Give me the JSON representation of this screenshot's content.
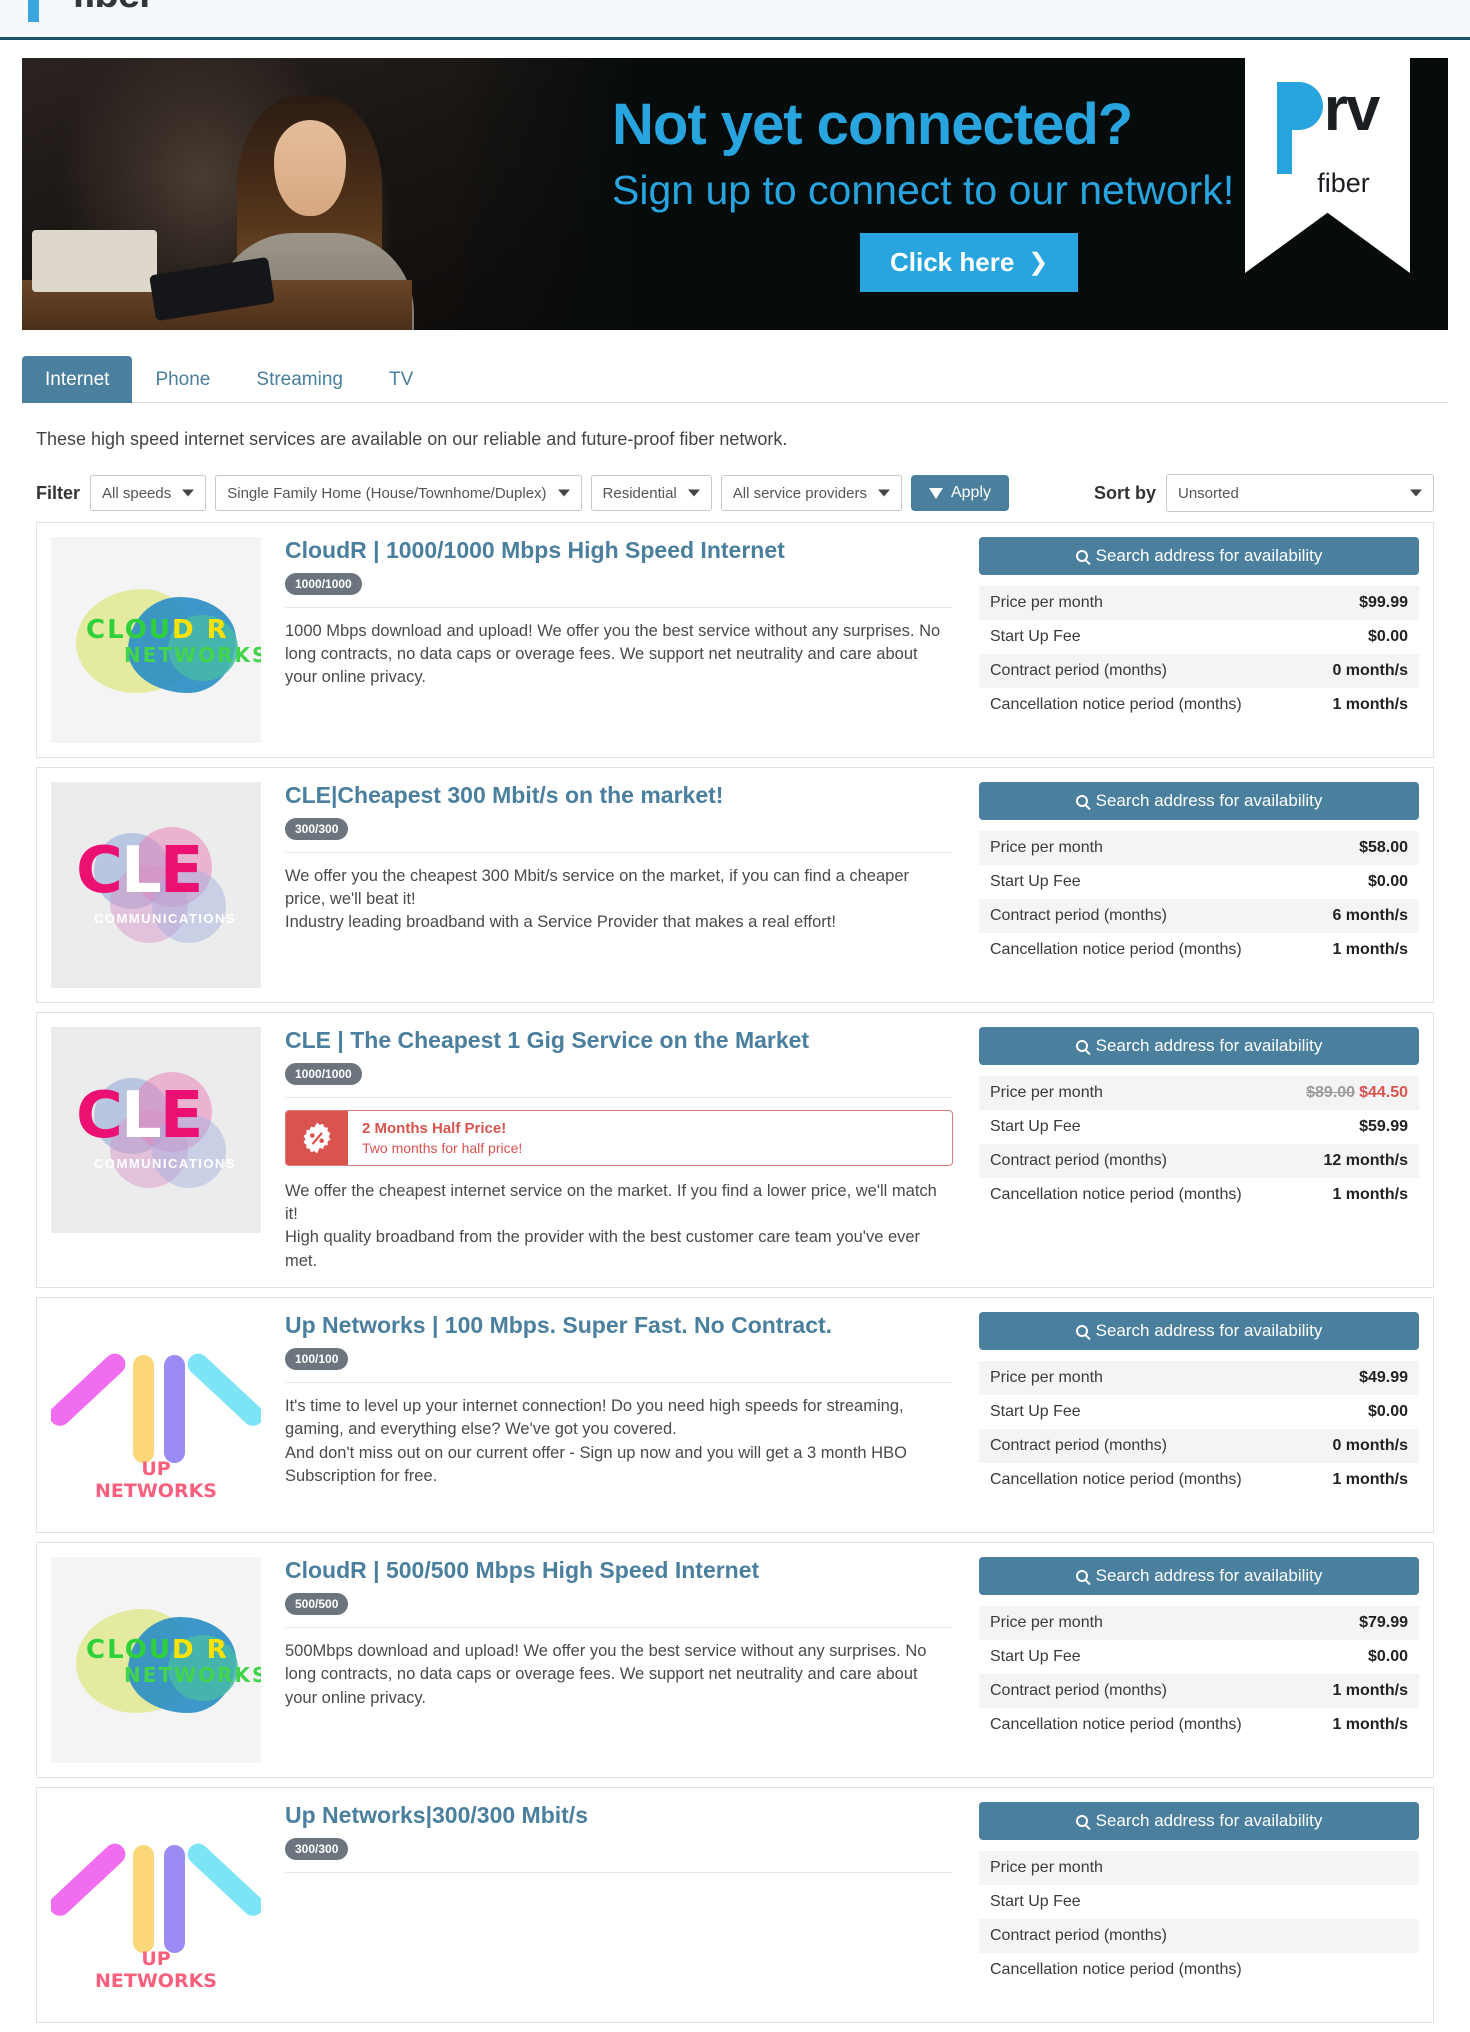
{
  "header": {
    "brand": "fiber",
    "logo_icon": "prv-p-mark-icon"
  },
  "banner": {
    "headline": "Not yet connected?",
    "subheadline": "Sign up to connect to our network!",
    "cta_label": "Click here",
    "cta_chevron": "❯",
    "ribbon_brand_rv": "rv",
    "ribbon_brand_sub": "fiber",
    "ribbon_icon": "prv-fiber-ribbon-logo-icon"
  },
  "tabs": [
    {
      "label": "Internet",
      "active": true
    },
    {
      "label": "Phone",
      "active": false
    },
    {
      "label": "Streaming",
      "active": false
    },
    {
      "label": "TV",
      "active": false
    }
  ],
  "intro": "These high speed internet services are available on our reliable and future-proof fiber network.",
  "filters": {
    "label": "Filter",
    "speed": "All speeds",
    "home_type": "Single Family Home (House/Townhome/Duplex)",
    "segment": "Residential",
    "provider": "All service providers",
    "apply_label": "Apply",
    "apply_icon": "funnel-icon"
  },
  "sort": {
    "label": "Sort by",
    "value": "Unsorted"
  },
  "spec_labels": {
    "price": "Price per month",
    "startup": "Start Up Fee",
    "contract": "Contract period (months)",
    "cancellation": "Cancellation notice period (months)"
  },
  "search_button_label": "Search address for availability",
  "search_button_icon": "magnifier-icon",
  "products": [
    {
      "logo_kind": "cloudr",
      "logo_alt": "cloudr-networks-logo",
      "title": "CloudR | 1000/1000 Mbps High Speed Internet",
      "speed_badge": "1000/1000",
      "description": "1000 Mbps download and upload! We offer you the best service without any surprises. No long contracts, no data caps or overage fees. We support net neutrality and care about your online privacy.",
      "promo": null,
      "price": "$99.99",
      "price_old": null,
      "startup": "$0.00",
      "contract": "0 month/s",
      "cancellation": "1 month/s"
    },
    {
      "logo_kind": "cle",
      "logo_alt": "cle-communications-logo",
      "title": "CLE|Cheapest 300 Mbit/s on the market!",
      "speed_badge": "300/300",
      "description": "We offer you the cheapest 300 Mbit/s service on the market, if you can find a cheaper price, we'll beat it!\nIndustry leading broadband with a Service Provider that makes a real effort!",
      "promo": null,
      "price": "$58.00",
      "price_old": null,
      "startup": "$0.00",
      "contract": "6 month/s",
      "cancellation": "1 month/s"
    },
    {
      "logo_kind": "cle",
      "logo_alt": "cle-communications-logo",
      "title": "CLE | The Cheapest 1 Gig Service on the Market",
      "speed_badge": "1000/1000",
      "description": "We offer the cheapest internet service on the market. If you find a lower price, we'll match it!\nHigh quality broadband from the provider with the best customer care team you've ever met.",
      "promo": {
        "icon": "percent-badge-icon",
        "title": "2 Months Half Price!",
        "subtitle": "Two months for half price!"
      },
      "price": "$44.50",
      "price_old": "$89.00",
      "startup": "$59.99",
      "contract": "12 month/s",
      "cancellation": "1 month/s"
    },
    {
      "logo_kind": "up",
      "logo_alt": "up-networks-logo",
      "title": "Up Networks | 100 Mbps. Super Fast. No Contract.",
      "speed_badge": "100/100",
      "description": "It's time to level up your internet connection! Do you need high speeds for streaming, gaming, and everything else? We've got you covered.\nAnd don't miss out on our current offer - Sign up now and you will get a 3 month HBO Subscription for free.",
      "promo": null,
      "price": "$49.99",
      "price_old": null,
      "startup": "$0.00",
      "contract": "0 month/s",
      "cancellation": "1 month/s"
    },
    {
      "logo_kind": "cloudr",
      "logo_alt": "cloudr-networks-logo",
      "title": "CloudR | 500/500 Mbps High Speed Internet",
      "speed_badge": "500/500",
      "description": "500Mbps download and upload! We offer you the best service without any surprises. No long contracts, no data caps or overage fees. We support net neutrality and care about your online privacy.",
      "promo": null,
      "price": "$79.99",
      "price_old": null,
      "startup": "$0.00",
      "contract": "1 month/s",
      "cancellation": "1 month/s"
    },
    {
      "logo_kind": "up",
      "logo_alt": "up-networks-logo",
      "title": "Up Networks|300/300 Mbit/s",
      "speed_badge": "300/300",
      "description": "",
      "promo": null,
      "price": "",
      "price_old": null,
      "startup": "",
      "contract": "",
      "cancellation": ""
    }
  ],
  "colors": {
    "accent": "#4a7f9e",
    "brand_blue": "#28a4de",
    "promo_red": "#d9534f",
    "badge_grey": "#6c757d"
  }
}
